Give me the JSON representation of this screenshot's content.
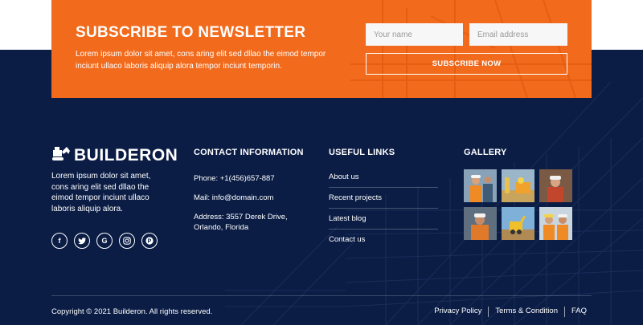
{
  "newsletter": {
    "title": "SUBSCRIBE TO NEWSLETTER",
    "text": "Lorem ipsum dolor sit amet, cons aring elit sed dllao the eimod tempor inciunt ullaco laboris aliquip alora tempor inciunt temporin.",
    "name_placeholder": "Your name",
    "email_placeholder": "Email address",
    "button_label": "SUBSCRIBE NOW",
    "accent_color": "#f26a1b"
  },
  "about": {
    "logo_text": "BUILDERON",
    "logo_icon": "excavator-icon",
    "text": "Lorem ipsum dolor sit amet, cons aring elit sed dllao the eimod tempor inciunt ullaco laboris aliquip alora.",
    "socials": [
      {
        "icon": "facebook-icon",
        "glyph": "f"
      },
      {
        "icon": "twitter-icon",
        "glyph": "t"
      },
      {
        "icon": "google-icon",
        "glyph": "G"
      },
      {
        "icon": "instagram-icon",
        "glyph": "◎"
      },
      {
        "icon": "pinterest-icon",
        "glyph": "P"
      }
    ]
  },
  "contact": {
    "title": "CONTACT INFORMATION",
    "phone": "Phone: +1(456)657-887",
    "mail": "Mail: info@domain.com",
    "address": "Address: 3557 Derek Drive, Orlando, Florida"
  },
  "links": {
    "title": "USEFUL LINKS",
    "items": [
      "About us",
      "Recent projects",
      "Latest blog",
      "Contact us"
    ]
  },
  "gallery": {
    "title": "GALLERY"
  },
  "bottom": {
    "copyright": "Copyright © 2021 Builderon. All rights reserved.",
    "links": [
      "Privacy Policy",
      "Terms & Condition",
      "FAQ"
    ]
  },
  "colors": {
    "footer_bg": "#0b1d45",
    "accent": "#f26a1b"
  }
}
